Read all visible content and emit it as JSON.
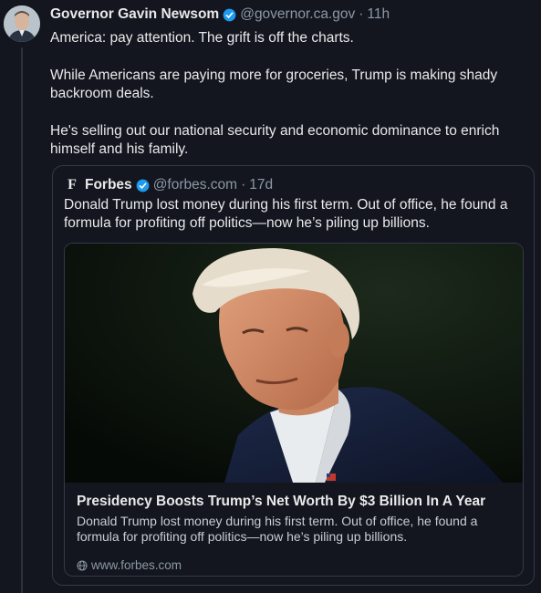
{
  "post": {
    "author_name": "Governor Gavin Newsom",
    "handle": "@governor.ca.gov",
    "separator": "·",
    "time": "11h",
    "paragraphs": [
      "America: pay attention. The grift is off the charts.",
      "While Americans are paying more for groceries, Trump is making shady backroom deals.",
      "He's selling out our national security and economic dominance to enrich himself and his family."
    ]
  },
  "quote": {
    "author_name": "Forbes",
    "logo_letter": "F",
    "handle": "@forbes.com",
    "separator": "·",
    "time": "17d",
    "text": "Donald Trump lost money during his first term. Out of office, he found a formula for profiting off politics—now he’s piling up billions.",
    "card": {
      "title": "Presidency Boosts Trump’s Net Worth By $3 Billion In A Year",
      "description": "Donald Trump lost money during his first term. Out of office, he found a formula for profiting off politics—now he’s piling up billions.",
      "link": "www.forbes.com"
    }
  },
  "colors": {
    "background": "#14161f",
    "verified": "#1d9bf0",
    "muted_text": "#8b98a5",
    "border": "#333946"
  },
  "icons": {
    "verified": "verified-badge-icon",
    "globe": "globe-icon"
  }
}
